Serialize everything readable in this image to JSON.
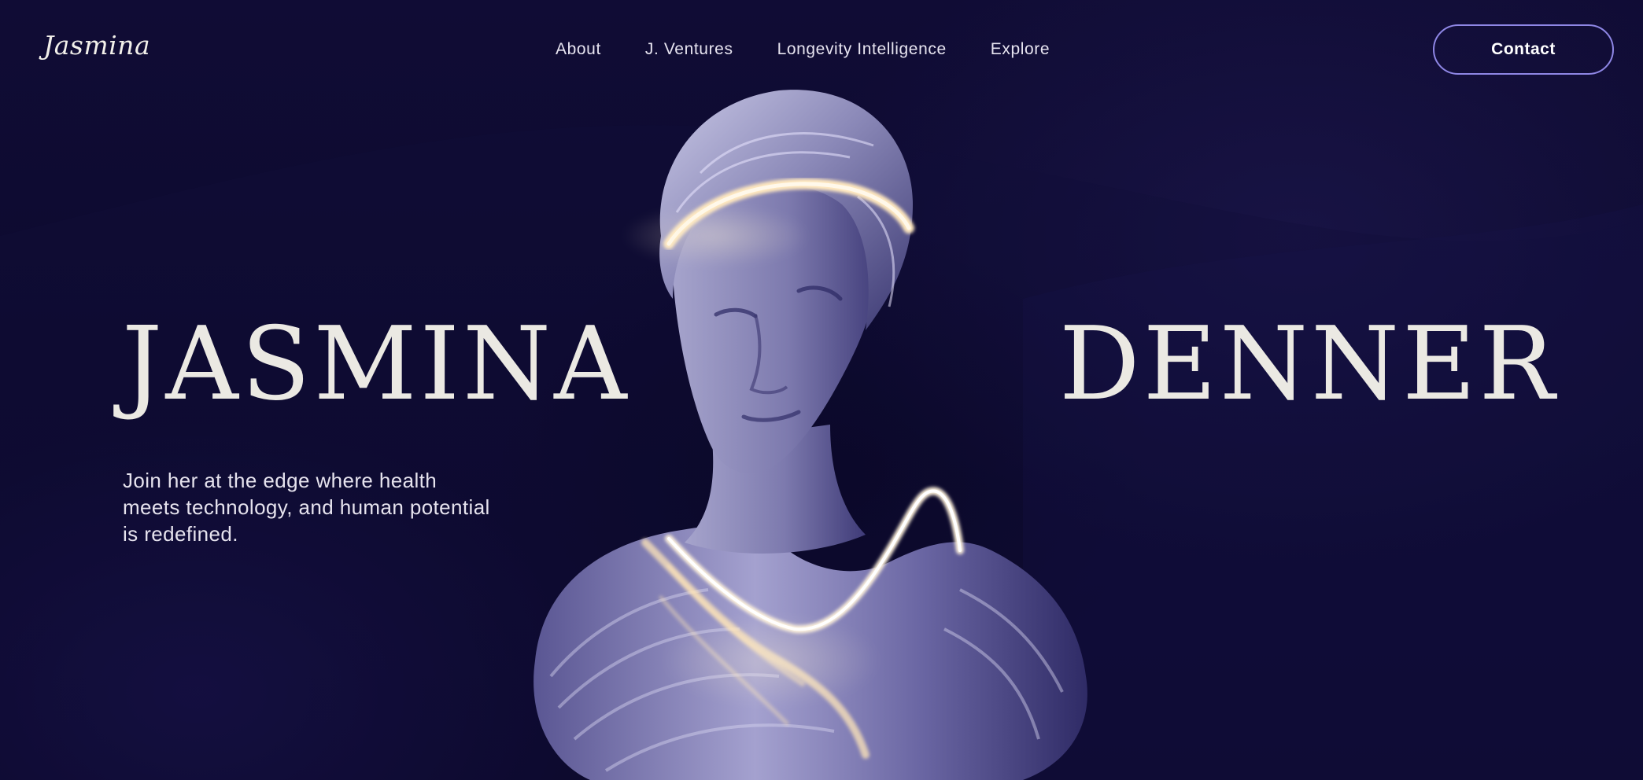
{
  "header": {
    "logo": "Jasmina",
    "nav": [
      {
        "label": "About"
      },
      {
        "label": "J. Ventures"
      },
      {
        "label": "Longevity Intelligence"
      },
      {
        "label": "Explore"
      }
    ],
    "contact_label": "Contact"
  },
  "hero": {
    "first_name": "JASMINA",
    "last_name": "DENNER",
    "tagline": "Join her at the edge where health meets technology, and human potential is redefined.",
    "image": "glowing-marble-statue-bust"
  },
  "colors": {
    "background": "#0d0a2e",
    "headline": "#ebe9e3",
    "button_border": "#8f87e6",
    "glow": "#ffe6b8"
  }
}
